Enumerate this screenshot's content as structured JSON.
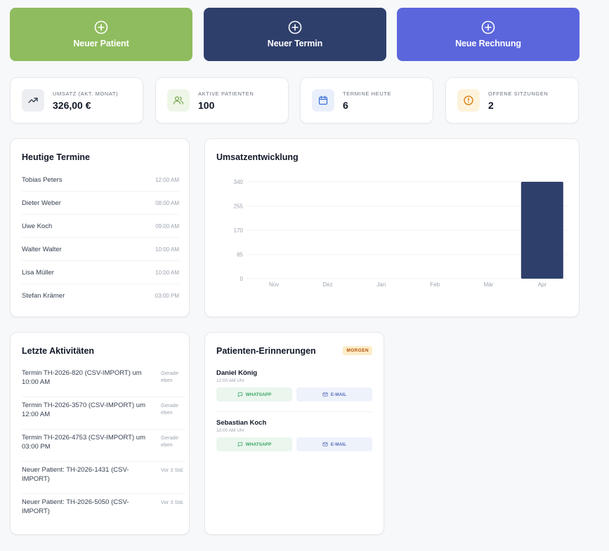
{
  "actions": [
    {
      "label": "Neuer Patient",
      "icon": "plus-circle-icon",
      "color": "#8fbc5e"
    },
    {
      "label": "Neuer Termin",
      "icon": "plus-circle-icon",
      "color": "#2f3f6c"
    },
    {
      "label": "Neue Rechnung",
      "icon": "plus-circle-icon",
      "color": "#5b66dc"
    }
  ],
  "stats": [
    {
      "label": "UMSATZ (AKT. MONAT)",
      "value": "326,00 €",
      "icon": "trend-up-icon"
    },
    {
      "label": "AKTIVE PATIENTEN",
      "value": "100",
      "icon": "users-icon"
    },
    {
      "label": "TERMINE HEUTE",
      "value": "6",
      "icon": "calendar-icon"
    },
    {
      "label": "OFFENE SITZUNGEN",
      "value": "2",
      "icon": "alert-circle-icon"
    }
  ],
  "today": {
    "title": "Heutige Termine",
    "items": [
      {
        "name": "Tobias Peters",
        "time": "12:00 AM"
      },
      {
        "name": "Dieter Weber",
        "time": "08:00 AM"
      },
      {
        "name": "Uwe Koch",
        "time": "09:00 AM"
      },
      {
        "name": "Walter Walter",
        "time": "10:00 AM"
      },
      {
        "name": "Lisa Müller",
        "time": "10:00 AM"
      },
      {
        "name": "Stefan Krämer",
        "time": "03:00 PM"
      }
    ]
  },
  "chart_data": {
    "type": "bar",
    "title": "Umsatzentwicklung",
    "categories": [
      "Nov",
      "Dez",
      "Jan",
      "Feb",
      "Mär",
      "Apr"
    ],
    "values": [
      0,
      0,
      0,
      0,
      0,
      340
    ],
    "ylim": [
      0,
      340
    ],
    "yticks": [
      0,
      85,
      170,
      255,
      340
    ],
    "bar_color": "#2f3f6c",
    "grid": true
  },
  "activity": {
    "title": "Letzte Aktivitäten",
    "items": [
      {
        "text": "Termin TH-2026-820 (CSV-IMPORT) um 10:00 AM",
        "time": "Gerade eben"
      },
      {
        "text": "Termin TH-2026-3570 (CSV-IMPORT) um 12:00 AM",
        "time": "Gerade eben"
      },
      {
        "text": "Termin TH-2026-4753 (CSV-IMPORT) um 03:00 PM",
        "time": "Gerade eben"
      },
      {
        "text": "Neuer Patient: TH-2026-1431 (CSV-IMPORT)",
        "time": "Vor 3 Std."
      },
      {
        "text": "Neuer Patient: TH-2026-5050 (CSV-IMPORT)",
        "time": "Vor 3 Std."
      }
    ]
  },
  "reminders": {
    "title": "Patienten-Erinnerungen",
    "badge": "MORGEN",
    "items": [
      {
        "name": "Daniel König",
        "time": "12:00 AM Uhr",
        "whatsapp": "WHATSAPP",
        "email": "E-MAIL"
      },
      {
        "name": "Sebastian Koch",
        "time": "10:00 AM Uhr",
        "whatsapp": "WHATSAPP",
        "email": "E-MAIL"
      }
    ]
  }
}
